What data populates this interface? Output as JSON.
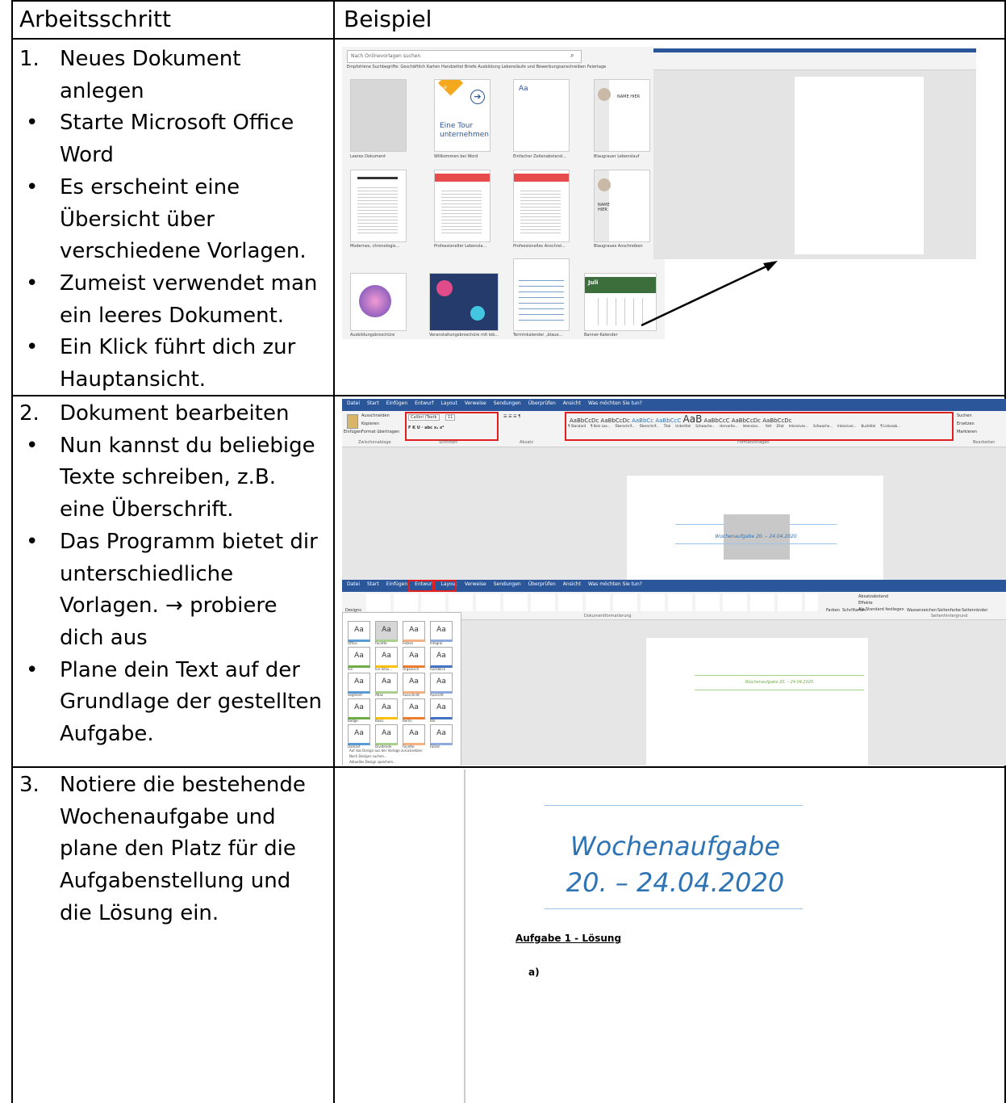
{
  "table": {
    "headers": [
      "Arbeitsschritt",
      "Beispiel"
    ],
    "rows": [
      {
        "lines": [
          {
            "marker": "1.",
            "text": "Neues Dokument"
          },
          {
            "marker": "",
            "text": "anlegen"
          },
          {
            "marker": "•",
            "text": "Starte Microsoft Office"
          },
          {
            "marker": "",
            "text": "Word"
          },
          {
            "marker": "•",
            "text": "Es erscheint eine"
          },
          {
            "marker": "",
            "text": "Übersicht über"
          },
          {
            "marker": "",
            "text": "verschiedene Vorlagen."
          },
          {
            "marker": "•",
            "text": "Zumeist verwendet man"
          },
          {
            "marker": "",
            "text": "ein leeres Dokument."
          },
          {
            "marker": "•",
            "text": "Ein Klick führt dich zur"
          },
          {
            "marker": "",
            "text": "Hauptansicht."
          }
        ]
      },
      {
        "lines": [
          {
            "marker": "2.",
            "text": "Dokument bearbeiten"
          },
          {
            "marker": "•",
            "text": "Nun kannst du beliebige"
          },
          {
            "marker": "",
            "text": "Texte schreiben, z.B."
          },
          {
            "marker": "",
            "text": "eine Überschrift."
          },
          {
            "marker": "•",
            "text": "Das Programm bietet dir"
          },
          {
            "marker": "",
            "text": "unterschiedliche"
          },
          {
            "marker": "",
            "text": "Vorlagen. → probiere"
          },
          {
            "marker": "",
            "text": "dich aus"
          },
          {
            "marker": "•",
            "text": "Plane dein Text auf der"
          },
          {
            "marker": "",
            "text": "Grundlage der gestellten"
          },
          {
            "marker": "",
            "text": "Aufgabe."
          }
        ]
      },
      {
        "lines": [
          {
            "marker": "3.",
            "text": "Notiere die bestehende"
          },
          {
            "marker": "",
            "text": "Wochenaufgabe und"
          },
          {
            "marker": "",
            "text": "plane den Platz für die"
          },
          {
            "marker": "",
            "text": "Aufgabenstellung und"
          },
          {
            "marker": "",
            "text": "die Lösung ein."
          }
        ]
      }
    ]
  },
  "screenshot1": {
    "search_placeholder": "Nach Onlinevorlagen suchen",
    "suggestions": "Empfohlene Suchbegriffe: Geschäftlich Karten Handzettel Briefe Ausbildung Lebensläufe und Bewerbungsanschreiben Feiertage",
    "templates": [
      "Leeres Dokument",
      "Willkommen bei Word",
      "Einfacher Zeilenabstand...",
      "Blaugrauer Lebenslauf",
      "Modernes, chronologis...",
      "Professioneller Lebensla...",
      "Professionelles Anschrei...",
      "Blaugraues Anschreiben",
      "Ausbildungsbroschüre",
      "Veranstaltungsbroschüre mit leb...",
      "Terminkalender „blaue...",
      "Banner-Kalender"
    ],
    "tour_text": "Eine Tour unternehmen",
    "neu_label": "Neu",
    "name_text": "NAME HIER",
    "juli_text": "Juli"
  },
  "screenshot2": {
    "tabs": [
      "Datei",
      "Start",
      "Einfügen",
      "Entwurf",
      "Layout",
      "Verweise",
      "Sendungen",
      "Überprüfen",
      "Ansicht",
      "Was möchten Sie tun?"
    ],
    "clipboard": [
      "Ausschneiden",
      "Kopieren",
      "Format übertragen"
    ],
    "paste": "Einfügen",
    "font": "Calibri (Textk",
    "size": "11",
    "styles": [
      "¶ Standard",
      "¶ Kein Lee...",
      "Überschrif...",
      "Überschrif...",
      "Titel",
      "Untertitel",
      "Schwache...",
      "Hervorhe...",
      "Intensive...",
      "Fett",
      "Zitat",
      "Intensives...",
      "Schwache...",
      "Intensiver...",
      "Buchtitel",
      "¶ Listenab..."
    ],
    "groups": [
      "Zwischenablage",
      "Schriftart",
      "Absatz",
      "Formatvorlagen",
      "Bearbeiten"
    ],
    "edit": [
      "Suchen",
      "Ersetzen",
      "Markieren"
    ],
    "doc_title": "Wochenaufgabe 20. – 24.04.2020"
  },
  "screenshot3": {
    "tabs": [
      "Datei",
      "Start",
      "Einfügen",
      "Entwurf",
      "Layout",
      "Verweise",
      "Sendungen",
      "Überprüfen",
      "Ansicht",
      "Was möchten Sie tun?"
    ],
    "designs_label": "Designs",
    "group": "Dokumentformatierung",
    "group2": "Seitenhintergrund",
    "right": [
      "Absatzabstand",
      "Effekte",
      "Als Standard festlegen",
      "Farben",
      "Schriftarten",
      "Wasserzeichen",
      "Seitenfarbe",
      "Seitenränder"
    ],
    "themes": [
      "Office",
      "Facette",
      "Fetzen",
      "Integral",
      "Ion",
      "Ion-Sitzu...",
      "Organisch",
      "Rückblick",
      "Segment",
      "Atlas",
      "Ausschnitt",
      "Aussicht",
      "Badge",
      "Basis",
      "Berlin",
      "Blo",
      "Damast",
      "Dividende",
      "Facette",
      "Falzen"
    ],
    "panel_links": [
      "Auf das Design aus der Vorlage zurücksetzen",
      "Nach Designs suchen...",
      "Aktuelles Design speichern..."
    ],
    "doc_title": "Wochenaufgabe 20. – 24.04.2020"
  },
  "screenshot4": {
    "title_line1": "Wochenaufgabe",
    "title_line2": "20. – 24.04.2020",
    "heading": "Aufgabe 1 - Lösung",
    "item": "a)"
  }
}
